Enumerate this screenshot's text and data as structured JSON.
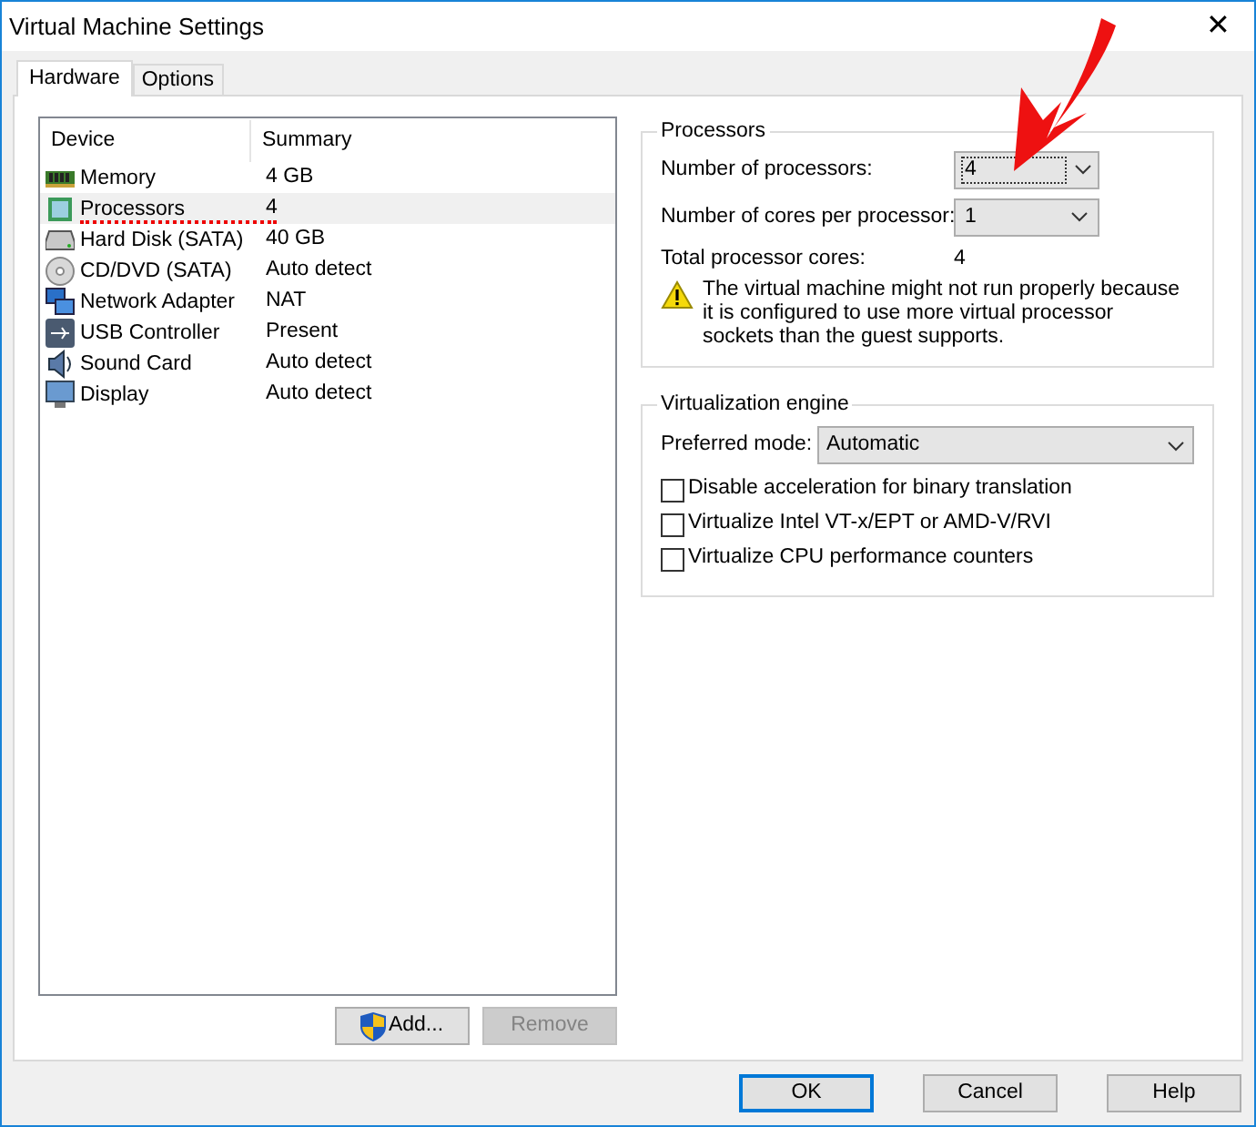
{
  "window": {
    "title": "Virtual Machine Settings",
    "close": "✕"
  },
  "tabs": [
    {
      "label": "Hardware",
      "selected": true
    },
    {
      "label": "Options",
      "selected": false
    }
  ],
  "device_list": {
    "columns": [
      "Device",
      "Summary"
    ],
    "rows": [
      {
        "kind": "memory",
        "device": "Memory",
        "summary": "4 GB",
        "selected": false
      },
      {
        "kind": "processor",
        "device": "Processors",
        "summary": "4",
        "selected": true
      },
      {
        "kind": "disk",
        "device": "Hard Disk (SATA)",
        "summary": "40 GB",
        "selected": false
      },
      {
        "kind": "cd",
        "device": "CD/DVD (SATA)",
        "summary": "Auto detect",
        "selected": false
      },
      {
        "kind": "network",
        "device": "Network Adapter",
        "summary": "NAT",
        "selected": false
      },
      {
        "kind": "usb",
        "device": "USB Controller",
        "summary": "Present",
        "selected": false
      },
      {
        "kind": "sound",
        "device": "Sound Card",
        "summary": "Auto detect",
        "selected": false
      },
      {
        "kind": "display",
        "device": "Display",
        "summary": "Auto detect",
        "selected": false
      }
    ]
  },
  "list_buttons": [
    {
      "label": "Add...",
      "shield": true,
      "disabled": false
    },
    {
      "label": "Remove",
      "shield": false,
      "disabled": true
    }
  ],
  "processors": {
    "title": "Processors",
    "number_label": "Number of processors:",
    "number_value": "4",
    "cores_label": "Number of cores per processor:",
    "cores_value": "1",
    "total_label": "Total processor cores:",
    "total_value": "4",
    "warning": "The virtual machine might not run properly because it is configured to use more virtual processor sockets than the guest supports."
  },
  "virtualization": {
    "title": "Virtualization engine",
    "mode_label": "Preferred mode:",
    "mode_value": "Automatic",
    "options": [
      {
        "label": "Disable acceleration for binary translation",
        "checked": false
      },
      {
        "label": "Virtualize Intel VT-x/EPT or AMD-V/RVI",
        "checked": false
      },
      {
        "label": "Virtualize CPU performance counters",
        "checked": false
      }
    ]
  },
  "buttons": [
    {
      "label": "OK",
      "default": true
    },
    {
      "label": "Cancel",
      "default": false
    },
    {
      "label": "Help",
      "default": false
    }
  ]
}
